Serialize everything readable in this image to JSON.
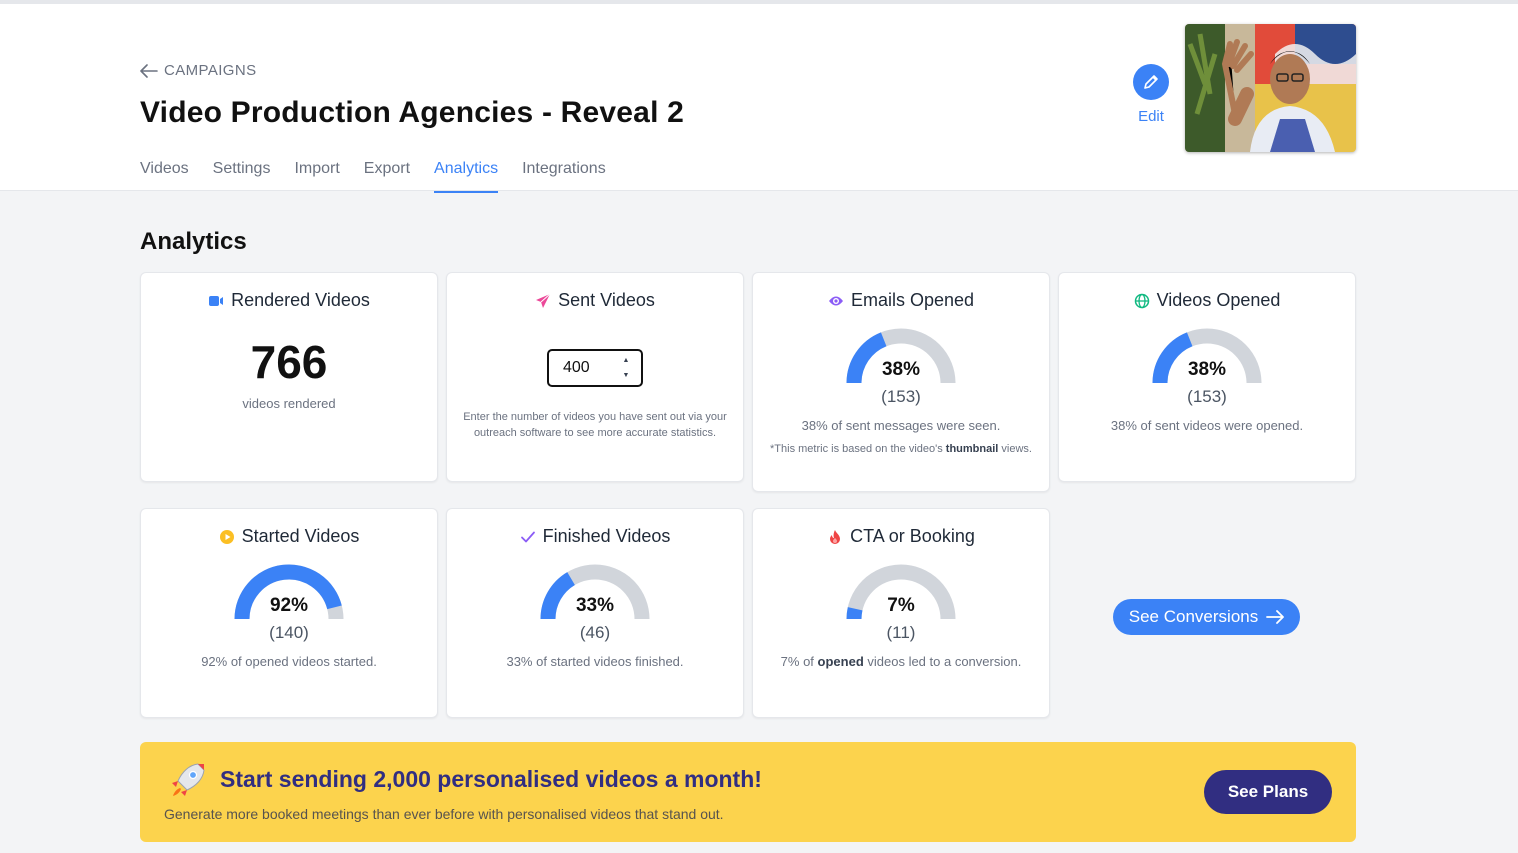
{
  "header": {
    "back_label": "CAMPAIGNS",
    "title": "Video Production Agencies - Reveal 2",
    "edit_label": "Edit",
    "tabs": [
      {
        "label": "Videos"
      },
      {
        "label": "Settings"
      },
      {
        "label": "Import"
      },
      {
        "label": "Export"
      },
      {
        "label": "Analytics",
        "active": true
      },
      {
        "label": "Integrations"
      }
    ]
  },
  "analytics": {
    "section_title": "Analytics",
    "rendered": {
      "title": "Rendered Videos",
      "icon": "video-camera-icon",
      "value": "766",
      "sub": "videos rendered"
    },
    "sent": {
      "title": "Sent Videos",
      "icon": "paper-plane-icon",
      "input_value": "400",
      "hint": "Enter the number of videos you have sent out via your outreach software to see more accurate statistics."
    },
    "emails_opened": {
      "title": "Emails Opened",
      "icon": "eye-icon",
      "percent": 38,
      "percent_label": "38%",
      "count": "(153)",
      "desc": "38% of sent messages were seen.",
      "note_pre": "*This metric is based on the video's ",
      "note_bold": "thumbnail",
      "note_post": " views."
    },
    "videos_opened": {
      "title": "Videos Opened",
      "icon": "globe-icon",
      "percent": 38,
      "percent_label": "38%",
      "count": "(153)",
      "desc": "38% of sent videos were opened."
    },
    "started": {
      "title": "Started Videos",
      "icon": "play-circle-icon",
      "percent": 92,
      "percent_label": "92%",
      "count": "(140)",
      "desc": "92% of opened videos started."
    },
    "finished": {
      "title": "Finished Videos",
      "icon": "check-icon",
      "percent": 33,
      "percent_label": "33%",
      "count": "(46)",
      "desc": "33% of started videos finished."
    },
    "cta": {
      "title": "CTA or Booking",
      "icon": "fire-icon",
      "percent": 7,
      "percent_label": "7%",
      "count": "(11)",
      "desc_pre": "7% of ",
      "desc_bold": "opened",
      "desc_post": " videos led to a conversion."
    },
    "conversions_button": "See Conversions"
  },
  "banner": {
    "title": "Start sending 2,000 personalised videos a month!",
    "subtitle": "Generate more booked meetings than ever before with personalised videos that stand out.",
    "button": "See Plans"
  },
  "colors": {
    "accent": "#3b82f6",
    "gauge_track": "#d1d5db",
    "banner_bg": "#fcd34d",
    "banner_dark": "#312e81"
  }
}
